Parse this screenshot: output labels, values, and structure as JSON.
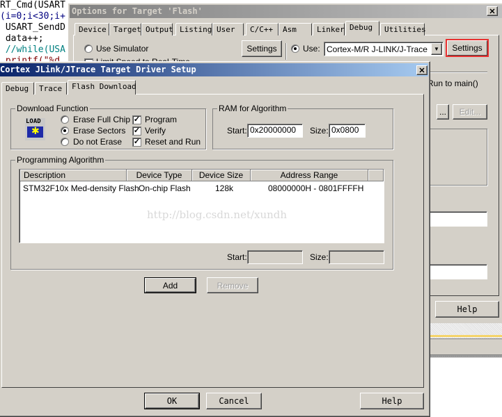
{
  "code_lines": [
    "RT_Cmd(USART",
    "(i=0;i<30;i+",
    " USART_SendD",
    " data++;",
    " //while(USA",
    " printf(\"%d"
  ],
  "outer": {
    "title": "Options for Target 'Flash'",
    "tabs": [
      "Device",
      "Target",
      "Output",
      "Listing",
      "User",
      "C/C++",
      "Asm",
      "Linker",
      "Debug",
      "Utilities"
    ],
    "active_tab": "Debug",
    "use_simulator": "Use Simulator",
    "limit_speed": "Limit Speed to Real-Time",
    "settings_label": "Settings",
    "use_label": "Use:",
    "driver": "Cortex-M/R J-LINK/J-Trace",
    "run_to_main": "Run to main()",
    "ellipsis": "...",
    "edit": "Edit...",
    "help": "Help",
    "highlight_color": "#e83030"
  },
  "inner": {
    "title": "Cortex JLink/JTrace Target Driver Setup",
    "tabs": [
      "Debug",
      "Trace",
      "Flash Download"
    ],
    "active_tab": "Flash Download",
    "download_function": {
      "label": "Download Function",
      "icon_text": "LOAD",
      "erase_options": [
        "Erase Full Chip",
        "Erase Sectors",
        "Do not Erase"
      ],
      "selected_erase": "Erase Sectors",
      "checks": [
        {
          "label": "Program",
          "checked": true
        },
        {
          "label": "Verify",
          "checked": true
        },
        {
          "label": "Reset and Run",
          "checked": true
        }
      ]
    },
    "ram": {
      "label": "RAM for Algorithm",
      "start_label": "Start:",
      "start": "0x20000000",
      "size_label": "Size:",
      "size": "0x0800"
    },
    "algorithm": {
      "label": "Programming Algorithm",
      "columns": [
        "Description",
        "Device Type",
        "Device Size",
        "Address Range"
      ],
      "rows": [
        [
          "STM32F10x Med-density Flash",
          "On-chip Flash",
          "128k",
          "08000000H - 0801FFFFH"
        ]
      ],
      "start_label": "Start:",
      "start": "",
      "size_label": "Size:",
      "size": ""
    },
    "watermark": "http://blog.csdn.net/xundh",
    "add": "Add",
    "remove": "Remove",
    "ok": "OK",
    "cancel": "Cancel",
    "help": "Help"
  }
}
